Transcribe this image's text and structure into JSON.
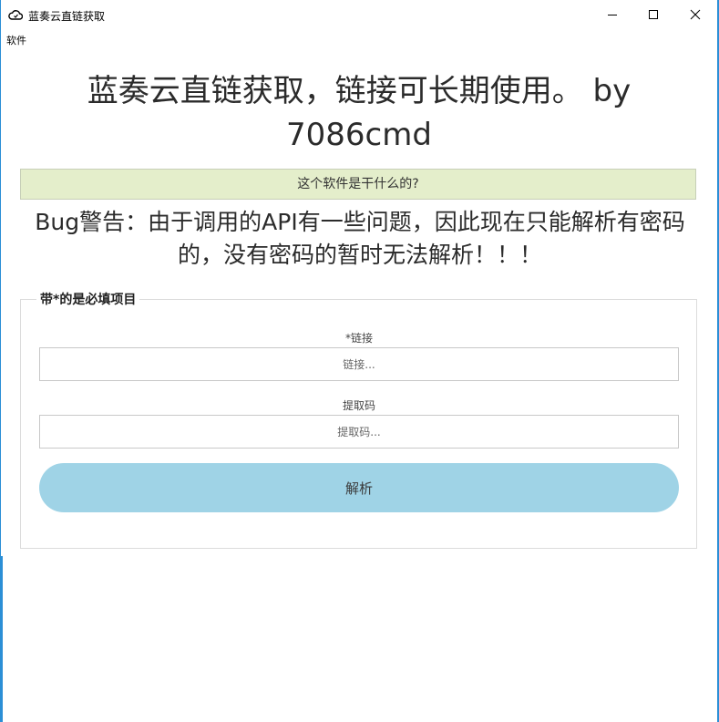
{
  "window": {
    "title": "蓝奏云直链获取",
    "icon": "cloud-icon",
    "controls": {
      "minimize_icon": "minimize-icon",
      "maximize_icon": "maximize-icon",
      "close_icon": "close-icon"
    }
  },
  "menu": {
    "items": [
      {
        "label": "软件"
      }
    ]
  },
  "heading": {
    "text": "蓝奏云直链获取，链接可长期使用。 by 7086cmd"
  },
  "info_bar": {
    "label": "这个软件是干什么的?"
  },
  "warning": {
    "text": "Bug警告：由于调用的API有一些问题，因此现在只能解析有密码的，没有密码的暂时无法解析！！！"
  },
  "form": {
    "legend": "带*的是必填项目",
    "link": {
      "label": "*链接",
      "value": "",
      "placeholder": "链接..."
    },
    "code": {
      "label": "提取码",
      "value": "",
      "placeholder": "提取码..."
    },
    "submit_label": "解析"
  },
  "colors": {
    "accent_border": "#2b8fd6",
    "info_bar_bg": "#e4eecb",
    "button_bg": "#9fd3e6"
  }
}
